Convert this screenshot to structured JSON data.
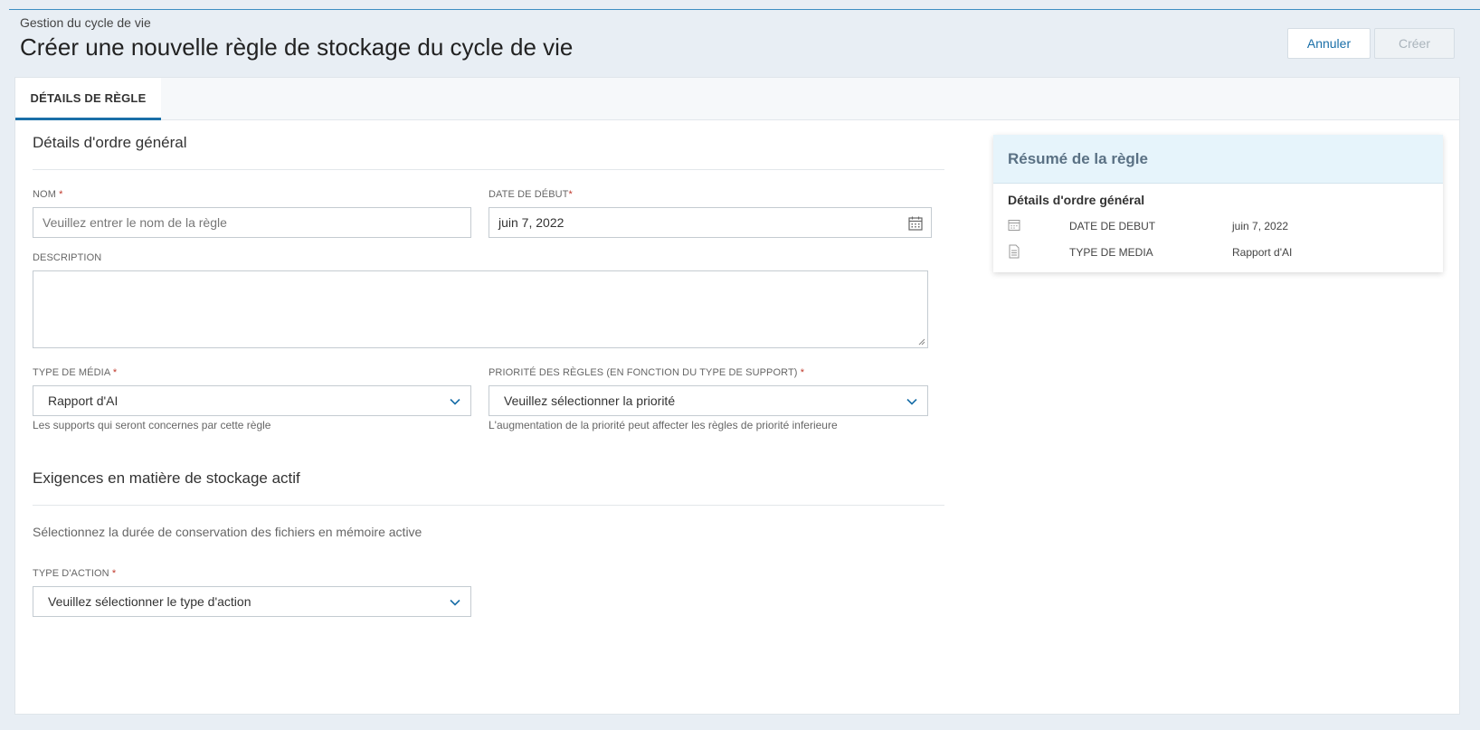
{
  "header": {
    "breadcrumb": "Gestion du cycle de vie",
    "title": "Créer une nouvelle règle de stockage du cycle de vie",
    "cancel_label": "Annuler",
    "create_label": "Créer"
  },
  "tabs": [
    {
      "label": "DÉTAILS DE RÈGLE",
      "active": true
    }
  ],
  "general": {
    "section_title": "Détails d'ordre général",
    "name": {
      "label": "NOM",
      "required": "*",
      "placeholder": "Veuillez entrer le nom de la règle",
      "value": ""
    },
    "start_date": {
      "label": "DATE DE DÉBUT",
      "required": "*",
      "value": "juin 7, 2022"
    },
    "description": {
      "label": "DESCRIPTION",
      "value": ""
    },
    "media_type": {
      "label": "TYPE DE MÉDIA",
      "required": "*",
      "value": "Rapport d'AI",
      "hint": "Les supports qui seront concernes par cette règle"
    },
    "priority": {
      "label": "PRIORITÉ DES RÈGLES (EN FONCTION DU TYPE DE SUPPORT)",
      "required": "*",
      "placeholder": "Veuillez sélectionner la priorité",
      "hint": "L'augmentation de la priorité peut affecter les règles de priorité inferieure"
    }
  },
  "active_storage": {
    "section_title": "Exigences en matière de stockage actif",
    "description": "Sélectionnez la durée de conservation des fichiers en mémoire active",
    "action_type": {
      "label": "TYPE D'ACTION",
      "required": "*",
      "placeholder": "Veuillez sélectionner le type d'action"
    }
  },
  "summary": {
    "title": "Résumé de la règle",
    "subtitle": "Détails d'ordre général",
    "rows": [
      {
        "icon": "calendar-icon",
        "key": "DATE DE DEBUT",
        "value": "juin 7, 2022"
      },
      {
        "icon": "document-icon",
        "key": "TYPE DE MEDIA",
        "value": "Rapport d'AI"
      }
    ]
  },
  "colors": {
    "accent": "#1a6fa8",
    "required": "#c0392b",
    "summary_header_bg": "#e6f4fb"
  }
}
